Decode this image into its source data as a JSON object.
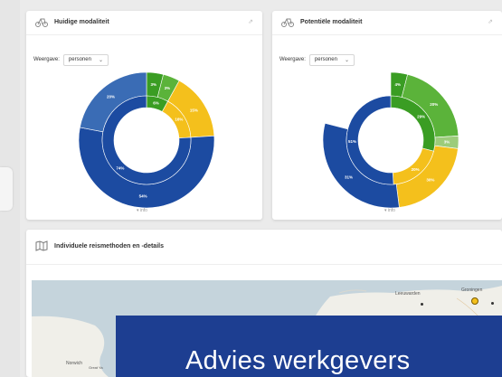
{
  "card_left": {
    "title": "Huidige modaliteit",
    "view_label": "Weergave:",
    "view_value": "personen",
    "info": "▾ info",
    "outer_labels": [
      "3%",
      "3%",
      "15%",
      "54%",
      "20%"
    ],
    "inner_labels": [
      "6%",
      "16%",
      "74%"
    ]
  },
  "card_right": {
    "title": "Potentiële modaliteit",
    "view_label": "Weergave:",
    "view_value": "personen",
    "info": "▾ info",
    "outer_labels": [
      "4%",
      "20%",
      "3%",
      "30%",
      "31%"
    ],
    "inner_labels": [
      "29%",
      "20%",
      "51%"
    ]
  },
  "map_section": {
    "title": "Individuele reismethoden en -details",
    "places": [
      "Leeuwarden",
      "Groningen",
      "Norwich",
      "Great Ya"
    ]
  },
  "overlay": {
    "text": "Advies werkgevers"
  },
  "colors": {
    "green_dark": "#3a9d23",
    "green_mid": "#5bb33a",
    "green_light": "#9ccc7a",
    "yellow": "#f4c01c",
    "blue_dark": "#1c4ba1",
    "blue_mid": "#3a6cb5",
    "overlay_blue": "#1d3e91"
  }
}
